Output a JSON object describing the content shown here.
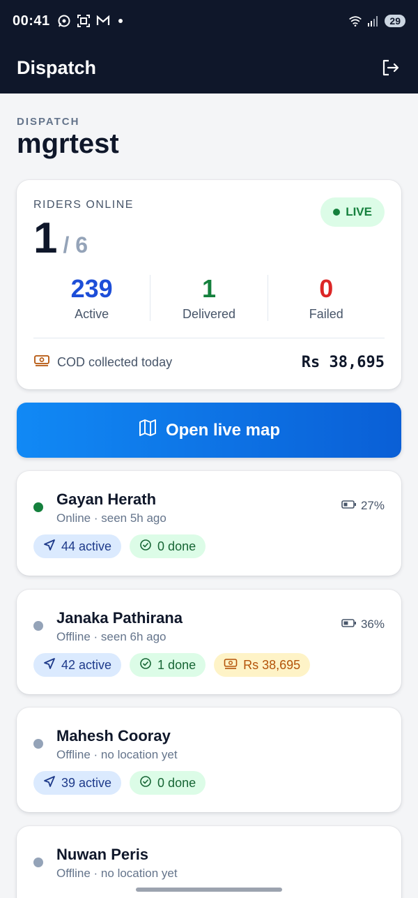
{
  "status_bar": {
    "time": "00:41",
    "battery": "29"
  },
  "app_bar": {
    "title": "Dispatch"
  },
  "page": {
    "eyebrow": "DISPATCH",
    "title": "mgrtest"
  },
  "summary": {
    "riders_label": "RIDERS ONLINE",
    "live_label": "LIVE",
    "online": "1",
    "total": "/ 6",
    "stats": [
      {
        "value": "239",
        "label": "Active",
        "color": "#1d4ed8"
      },
      {
        "value": "1",
        "label": "Delivered",
        "color": "#15803d"
      },
      {
        "value": "0",
        "label": "Failed",
        "color": "#dc2626"
      }
    ],
    "cod_label": "COD collected today",
    "cod_amount": "Rs 38,695"
  },
  "map_button": {
    "label": "Open live map"
  },
  "riders": [
    {
      "name": "Gayan Herath",
      "status": "Online · seen 5h ago",
      "online": true,
      "battery": "27%",
      "active": "44 active",
      "done": "0 done",
      "cod": ""
    },
    {
      "name": "Janaka Pathirana",
      "status": "Offline · seen 6h ago",
      "online": false,
      "battery": "36%",
      "active": "42 active",
      "done": "1 done",
      "cod": "Rs 38,695"
    },
    {
      "name": "Mahesh Cooray",
      "status": "Offline · no location yet",
      "online": false,
      "battery": "",
      "active": "39 active",
      "done": "0 done",
      "cod": ""
    },
    {
      "name": "Nuwan Peris",
      "status": "Offline · no location yet",
      "online": false,
      "battery": "",
      "active": "",
      "done": "",
      "cod": ""
    }
  ],
  "colors": {
    "online_dot": "#15803d",
    "offline_dot": "#94a3b8",
    "accent": "#1189f5",
    "header_bg": "#0f172a"
  }
}
